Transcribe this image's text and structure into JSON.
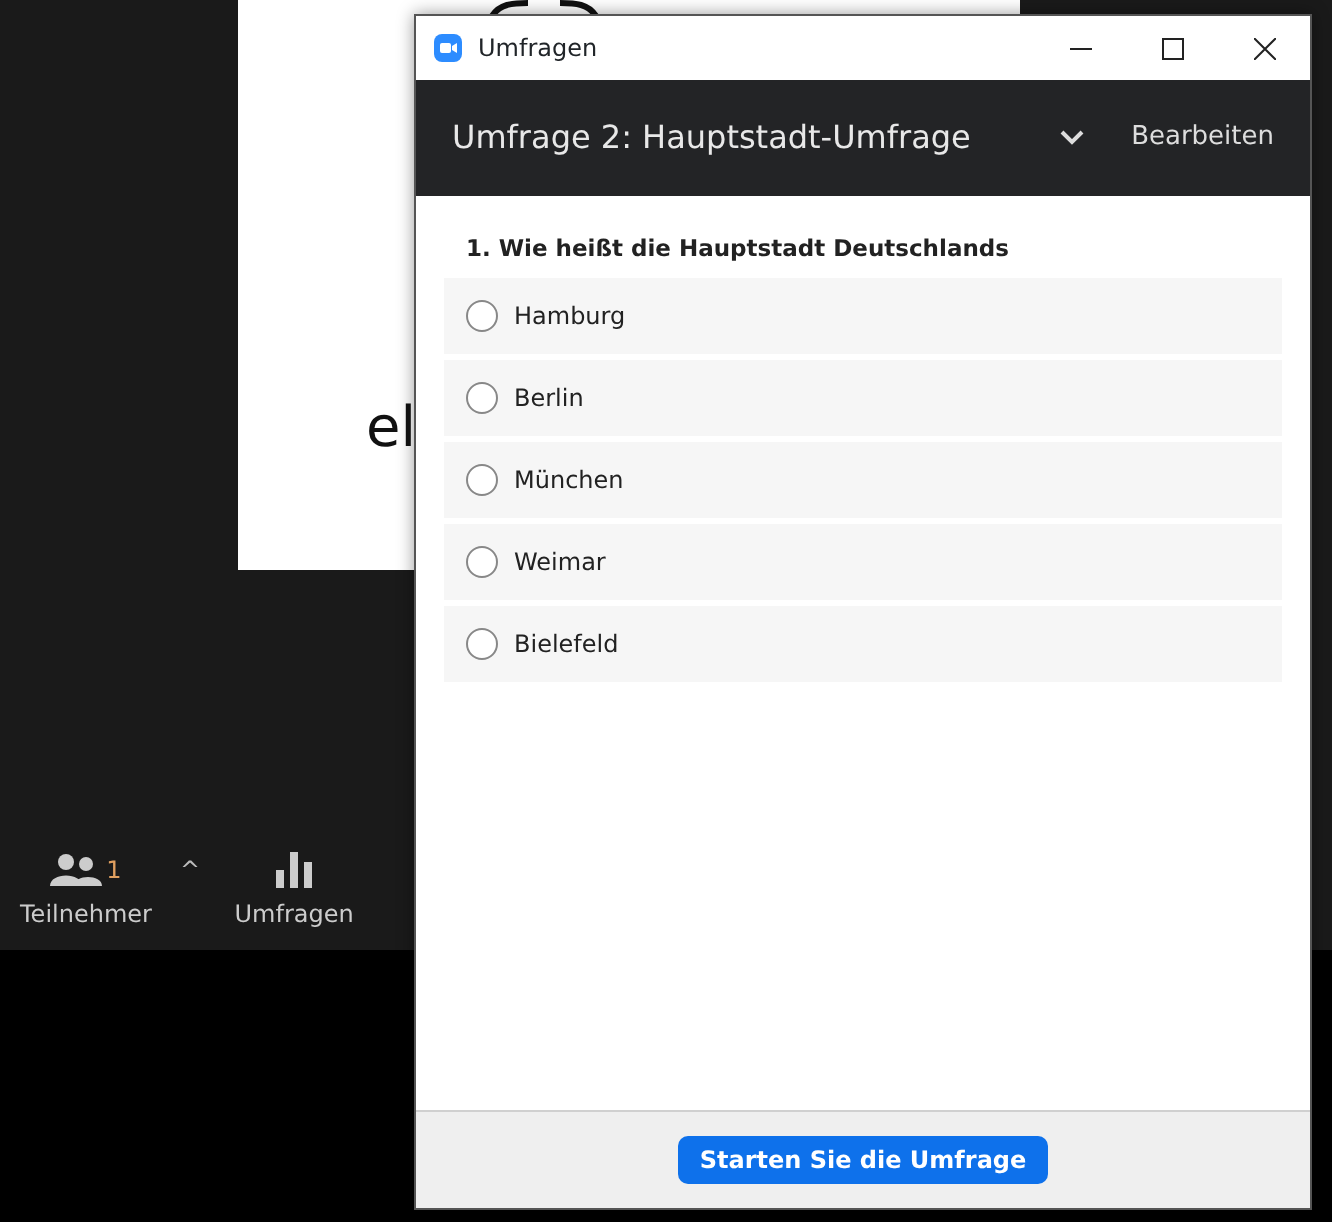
{
  "shared_screen": {
    "text": "el"
  },
  "toolbar": {
    "items": [
      {
        "kind": "participants",
        "label": "Teilnehmer",
        "count": "1",
        "caret": "^"
      },
      {
        "kind": "polls",
        "label": "Umfragen"
      }
    ]
  },
  "window": {
    "title": "Umfragen"
  },
  "poll": {
    "title": "Umfrage 2: Hauptstadt-Umfrage",
    "edit": "Bearbeiten",
    "question": "1. Wie heißt die Hauptstadt Deutschlands",
    "options": [
      {
        "label": "Hamburg",
        "selected": false
      },
      {
        "label": "Berlin",
        "selected": false
      },
      {
        "label": "München",
        "selected": false
      },
      {
        "label": "Weimar",
        "selected": false
      },
      {
        "label": "Bielefeld",
        "selected": false
      }
    ],
    "button": "Starten Sie die Umfrage"
  }
}
